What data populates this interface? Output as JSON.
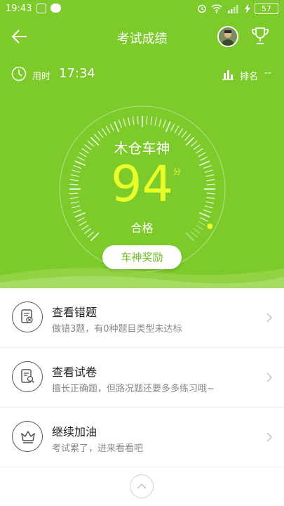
{
  "status": {
    "time": "19:43",
    "battery": "57"
  },
  "header": {
    "title": "考试成绩"
  },
  "meta": {
    "usetime_label": "用时",
    "usetime_value": "17:34",
    "rank_label": "排名",
    "rank_value": "--"
  },
  "result": {
    "rank_title": "木仓车神",
    "score": "94",
    "unit": "分",
    "status": "合格",
    "reward_button": "车神奖励"
  },
  "list": [
    {
      "title": "查看错题",
      "subtitle": "做错3题，有0种题目类型未达标",
      "icon": "wrong-questions-icon"
    },
    {
      "title": "查看试卷",
      "subtitle": "擅长正确题，但路况题还要多多练习哦~",
      "icon": "view-paper-icon"
    },
    {
      "title": "继续加油",
      "subtitle": "考试累了，进来看看吧",
      "icon": "crown-icon"
    }
  ],
  "colors": {
    "primary": "#7ccb2a",
    "score": "#e8ff2a",
    "reward_text": "#6fbe22"
  }
}
